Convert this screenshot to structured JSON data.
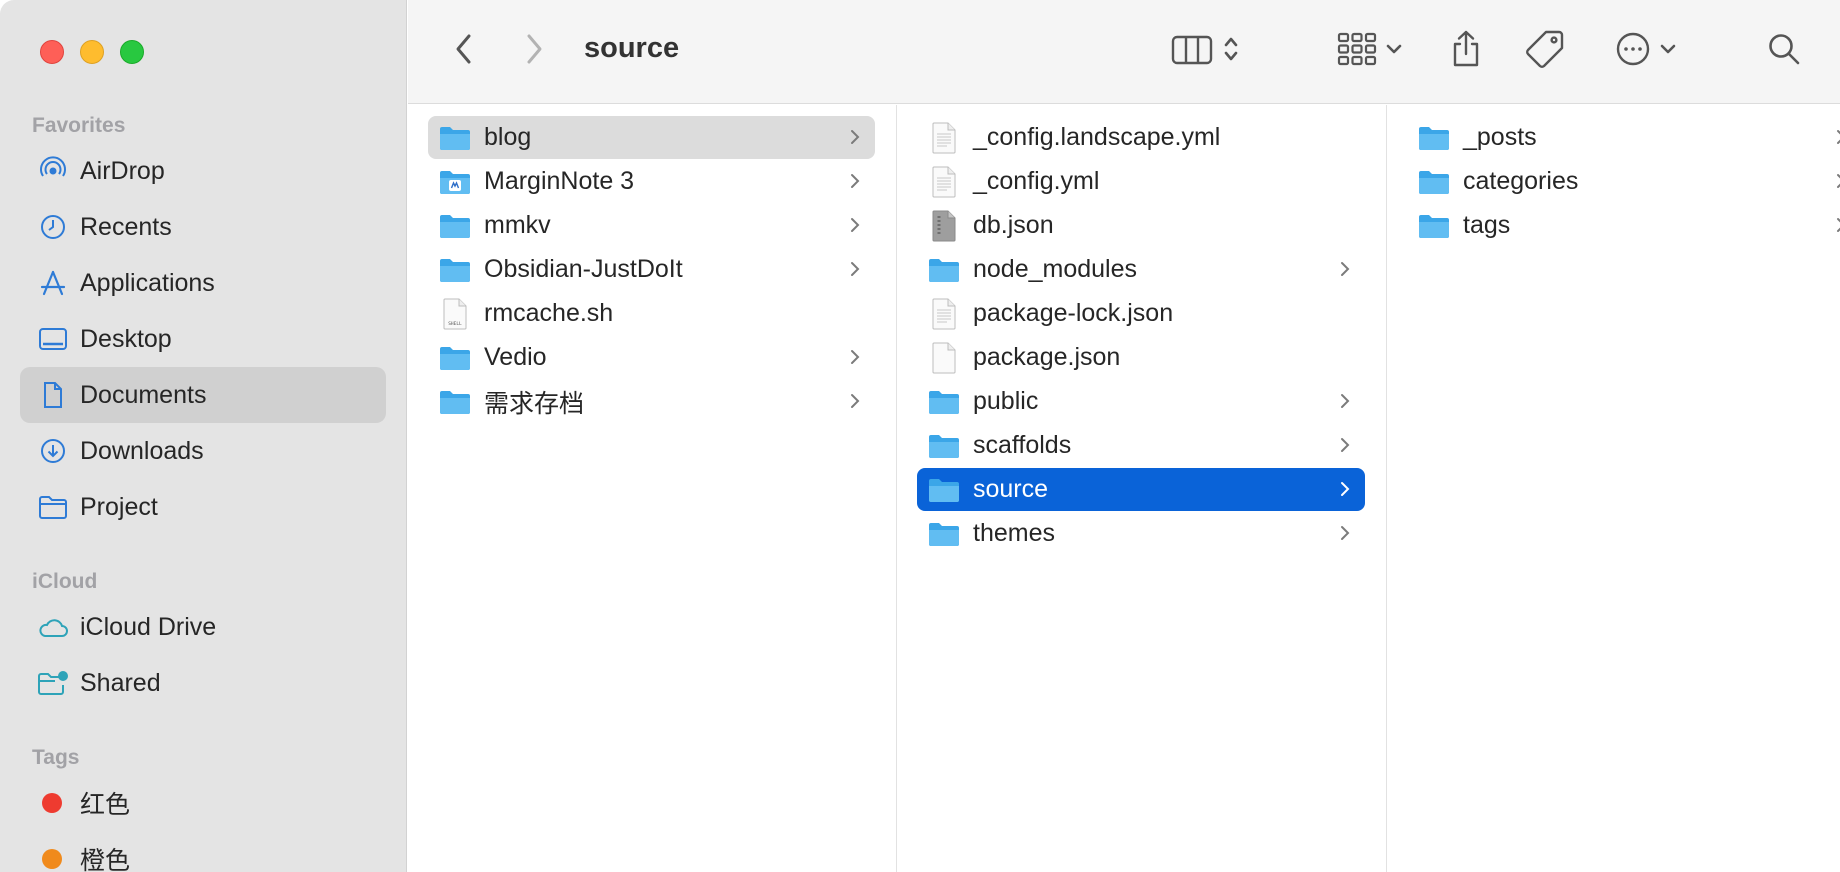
{
  "window": {
    "title": "source"
  },
  "sidebar": {
    "favorites_header": "Favorites",
    "favorites": [
      {
        "label": "AirDrop",
        "icon": "airdrop-icon"
      },
      {
        "label": "Recents",
        "icon": "clock-icon"
      },
      {
        "label": "Applications",
        "icon": "applications-icon"
      },
      {
        "label": "Desktop",
        "icon": "desktop-icon"
      },
      {
        "label": "Documents",
        "icon": "document-icon",
        "selected": true
      },
      {
        "label": "Downloads",
        "icon": "download-icon"
      },
      {
        "label": "Project",
        "icon": "folder-icon"
      }
    ],
    "icloud_header": "iCloud",
    "icloud": [
      {
        "label": "iCloud Drive",
        "icon": "cloud-icon"
      },
      {
        "label": "Shared",
        "icon": "shared-folder-icon"
      }
    ],
    "tags_header": "Tags",
    "tags": [
      {
        "label": "红色",
        "color": "#ee3b30"
      },
      {
        "label": "橙色",
        "color": "#f08a1c"
      }
    ]
  },
  "toolbar": {
    "back_icon": "chevron-left-icon",
    "forward_icon": "chevron-right-icon",
    "view_icon": "column-view-icon",
    "group_icon": "grid-group-icon",
    "share_icon": "share-icon",
    "tag_icon": "tag-icon",
    "more_icon": "ellipsis-circle-icon",
    "search_icon": "search-icon"
  },
  "columns": {
    "col1": [
      {
        "name": "blog",
        "type": "folder",
        "has_children": true,
        "highlight": "gray"
      },
      {
        "name": "MarginNote 3",
        "type": "app-folder",
        "has_children": true
      },
      {
        "name": "mmkv",
        "type": "folder",
        "has_children": true
      },
      {
        "name": "Obsidian-JustDoIt",
        "type": "folder",
        "has_children": true
      },
      {
        "name": "rmcache.sh",
        "type": "shell-file",
        "has_children": false
      },
      {
        "name": "Vedio",
        "type": "folder",
        "has_children": true
      },
      {
        "name": "需求存档",
        "type": "folder",
        "has_children": true
      }
    ],
    "col2": [
      {
        "name": "_config.landscape.yml",
        "type": "file",
        "has_children": false
      },
      {
        "name": "_config.yml",
        "type": "file",
        "has_children": false
      },
      {
        "name": "db.json",
        "type": "json-file",
        "has_children": false
      },
      {
        "name": "node_modules",
        "type": "folder",
        "has_children": true
      },
      {
        "name": "package-lock.json",
        "type": "file",
        "has_children": false
      },
      {
        "name": "package.json",
        "type": "file-blank",
        "has_children": false
      },
      {
        "name": "public",
        "type": "folder",
        "has_children": true
      },
      {
        "name": "scaffolds",
        "type": "folder",
        "has_children": true
      },
      {
        "name": "source",
        "type": "folder",
        "has_children": true,
        "highlight": "blue"
      },
      {
        "name": "themes",
        "type": "folder",
        "has_children": true
      }
    ],
    "col3": [
      {
        "name": "_posts",
        "type": "folder",
        "has_children": true
      },
      {
        "name": "categories",
        "type": "folder",
        "has_children": true
      },
      {
        "name": "tags",
        "type": "folder",
        "has_children": true
      }
    ]
  },
  "colors": {
    "accent": "#0a63d8",
    "folder": "#5ab8ef",
    "sidebar_icon": "#2e7bd6"
  }
}
